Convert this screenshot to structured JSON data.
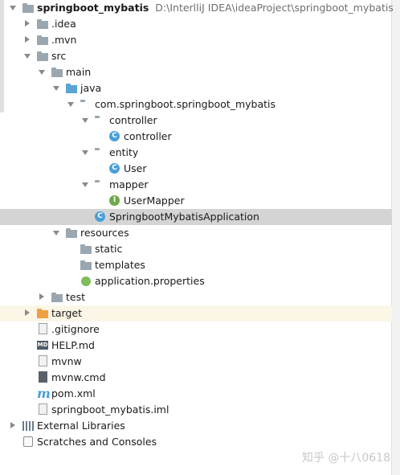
{
  "project": {
    "name": "springboot_mybatis",
    "path": "D:\\InterlliJ IDEA\\ideaProject\\springboot_mybatis"
  },
  "tree": {
    "idea": ".idea",
    "mvn": ".mvn",
    "src": "src",
    "main": "main",
    "java": "java",
    "package": "com.springboot.springboot_mybatis",
    "controller_pkg": "controller",
    "controller_class": "controller",
    "entity_pkg": "entity",
    "user_class": "User",
    "mapper_pkg": "mapper",
    "usermapper": "UserMapper",
    "app_class": "SpringbootMybatisApplication",
    "resources": "resources",
    "static": "static",
    "templates": "templates",
    "app_props": "application.properties",
    "test": "test",
    "target": "target",
    "gitignore": ".gitignore",
    "help": "HELP.md",
    "mvnw": "mvnw",
    "mvnw_cmd": "mvnw.cmd",
    "pom": "pom.xml",
    "iml": "springboot_mybatis.iml",
    "ext_libs": "External Libraries",
    "scratches": "Scratches and Consoles"
  },
  "icons": {
    "class_letter": "C",
    "interface_letter": "I",
    "md_badge": "MD",
    "maven_letter": "m"
  },
  "watermark": "知乎 @十八0618",
  "colors": {
    "selection": "#d4d4d4",
    "folder_gray": "#9aa7b0",
    "source_blue": "#5ba4d6",
    "excluded_orange": "#f0a040",
    "class_blue": "#4a9fd8",
    "interface_green": "#6ea84a"
  }
}
